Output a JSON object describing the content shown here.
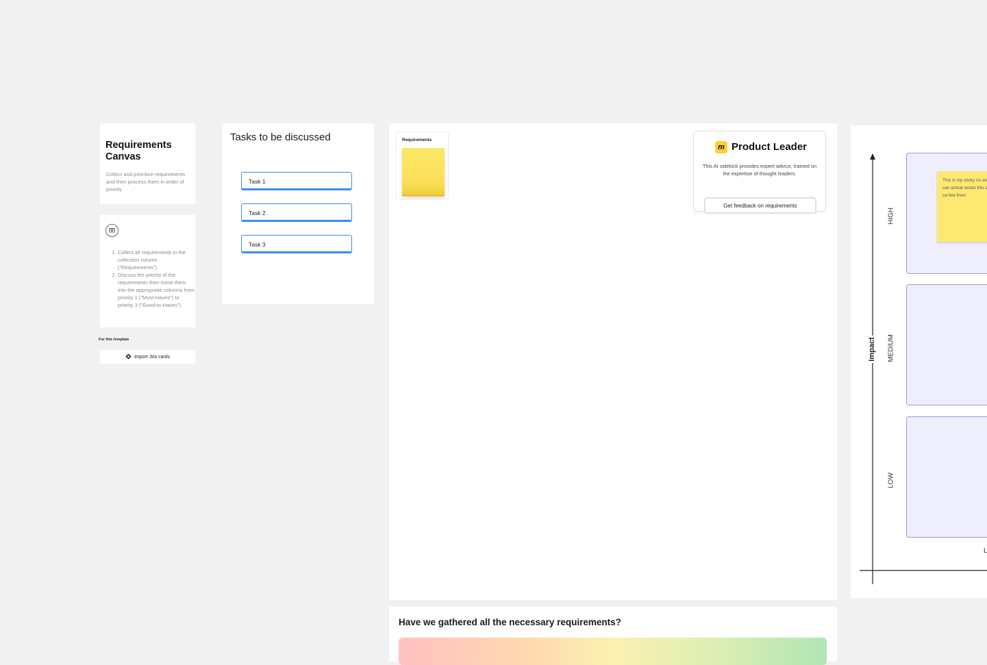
{
  "title_card": {
    "title": "Requirements Canvas",
    "subtitle": "Collect and prioritize requirements and then process them in order of priority"
  },
  "instructions": {
    "icon": "book-icon",
    "steps": [
      "Collect all requirements in the collection column (\"Requirements\").",
      "Discuss the priority of the requirements then move them into the appropriate columns from priority 1 (\"Must-Haves\") to priority 3 (\"Good-to-Haves\")."
    ]
  },
  "template_section": {
    "label": "For this template",
    "import_button": "Import Jira cards"
  },
  "tasks_frame": {
    "title": "Tasks to be discussed",
    "tasks": [
      "Task 1",
      "Task 2",
      "Task 3"
    ]
  },
  "requirements_column": {
    "label": "Requirements"
  },
  "product_leader": {
    "title": "Product Leader",
    "description": "This AI sidekick provides expert advice, trained on the expertise of thought leaders.",
    "button": "Get feedback on requirements"
  },
  "question_frame": {
    "title": "Have we gathered all the necessary requirements?"
  },
  "matrix": {
    "y_axis_label": "Impact",
    "rows": [
      "HIGH",
      "MEDIUM",
      "LOW"
    ],
    "x_label_partial": "L",
    "sticky_note": "This is my sticky no and you can actual resize this and it ca few lines"
  },
  "colors": {
    "canvas_bg": "#f1f1f1",
    "task_border": "#3a8ee6",
    "sticky": "#fde972",
    "matrix_cell_bg": "#eeeefd",
    "matrix_cell_border": "#9a9ae0",
    "brand_yellow": "#ffd02f"
  }
}
